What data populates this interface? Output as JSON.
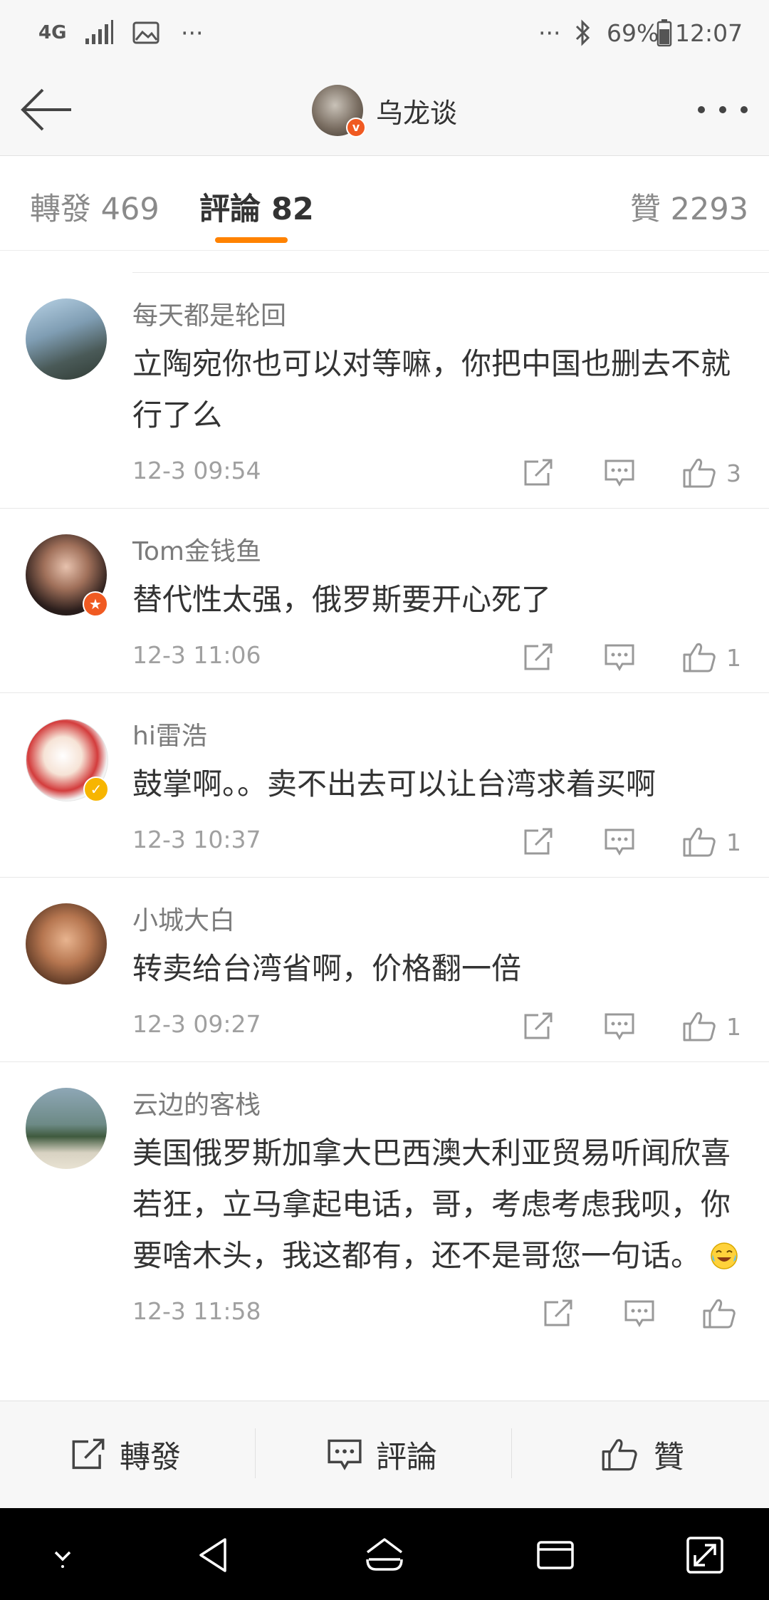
{
  "status_bar": {
    "network": "4G",
    "more_left": "···",
    "more_right": "···",
    "battery": "69%",
    "time": "12:07"
  },
  "header": {
    "title": "乌龙谈",
    "verified_mark": "v"
  },
  "tabs": {
    "repost": "轉發 469",
    "comments": "評論 82",
    "likes": "贊 2293"
  },
  "comments": [
    {
      "name": "每天都是轮回",
      "text": "立陶宛你也可以对等嘛，你把中国也删去不就行了么",
      "time": "12-3 09:54",
      "likes": "3"
    },
    {
      "name": "Tom金钱鱼",
      "text": "替代性太强，俄罗斯要开心死了",
      "time": "12-3 11:06",
      "likes": "1"
    },
    {
      "name": "hi雷浩",
      "text": "鼓掌啊。。卖不出去可以让台湾求着买啊",
      "time": "12-3 10:37",
      "likes": "1"
    },
    {
      "name": "小城大白",
      "text": "转卖给台湾省啊，价格翻一倍",
      "time": "12-3 09:27",
      "likes": "1"
    },
    {
      "name": "云边的客栈",
      "text": "美国俄罗斯加拿大巴西澳大利亚贸易听闻欣喜若狂，立马拿起电话，哥，考虑考虑我呗，你要啥木头，我这都有，还不是哥您一句话。",
      "time": "12-3 11:58",
      "likes": ""
    }
  ],
  "bottom_bar": {
    "repost": "轉發",
    "comment": "評論",
    "like": "贊"
  },
  "colors": {
    "accent": "#ff8200",
    "verified": "#f05a22",
    "verified_yellow": "#f7b500"
  }
}
